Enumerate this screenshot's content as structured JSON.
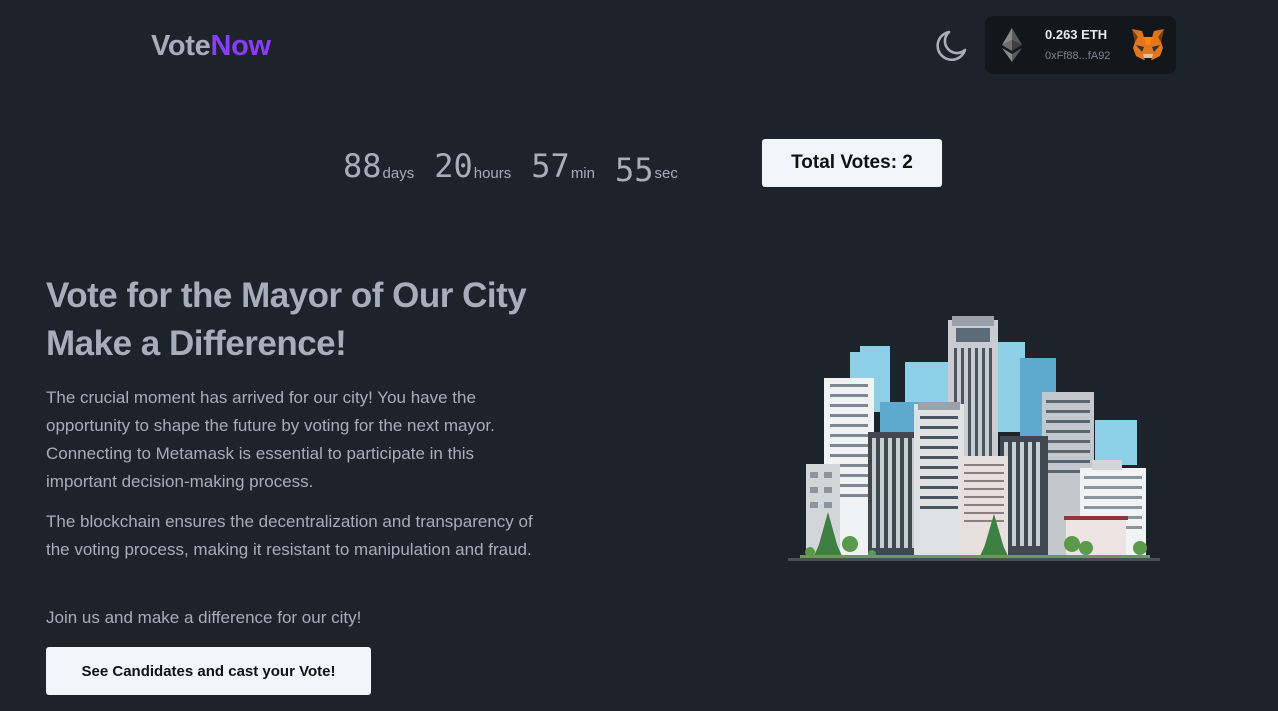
{
  "header": {
    "logo_part1": "Vote",
    "logo_part2": "Now",
    "theme_toggle_icon": "moon-icon",
    "wallet": {
      "balance": "0.263 ETH",
      "address": "0xFf88...fA92",
      "chain_icon": "ethereum-icon",
      "provider_icon": "metamask-fox-icon"
    }
  },
  "countdown": [
    {
      "value": "88",
      "unit": "days"
    },
    {
      "value": "20",
      "unit": "hours"
    },
    {
      "value": "57",
      "unit": "min"
    },
    {
      "value": "55",
      "unit": "sec"
    }
  ],
  "total_votes_label": "Total Votes: 2",
  "hero": {
    "title_line1": "Vote for the Mayor of Our City",
    "title_line2": "Make a Difference!",
    "paragraph1": "The crucial moment has arrived for our city! You have the opportunity to shape the future by voting for the next mayor. Connecting to Metamask is essential to participate in this important decision-making process.",
    "paragraph2": "The blockchain ensures the decentralization and transparency of the voting process, making it resistant to manipulation and fraud.",
    "paragraph3": "Join us and make a difference for our city!",
    "cta_label": "See Candidates and cast your Vote!",
    "illustration": "city-skyline-illustration"
  },
  "colors": {
    "background": "#1d232a",
    "text": "#a6adbb",
    "accent": "#8b3dff",
    "button_bg": "#f2f5f9",
    "wallet_bg": "#13171b"
  }
}
